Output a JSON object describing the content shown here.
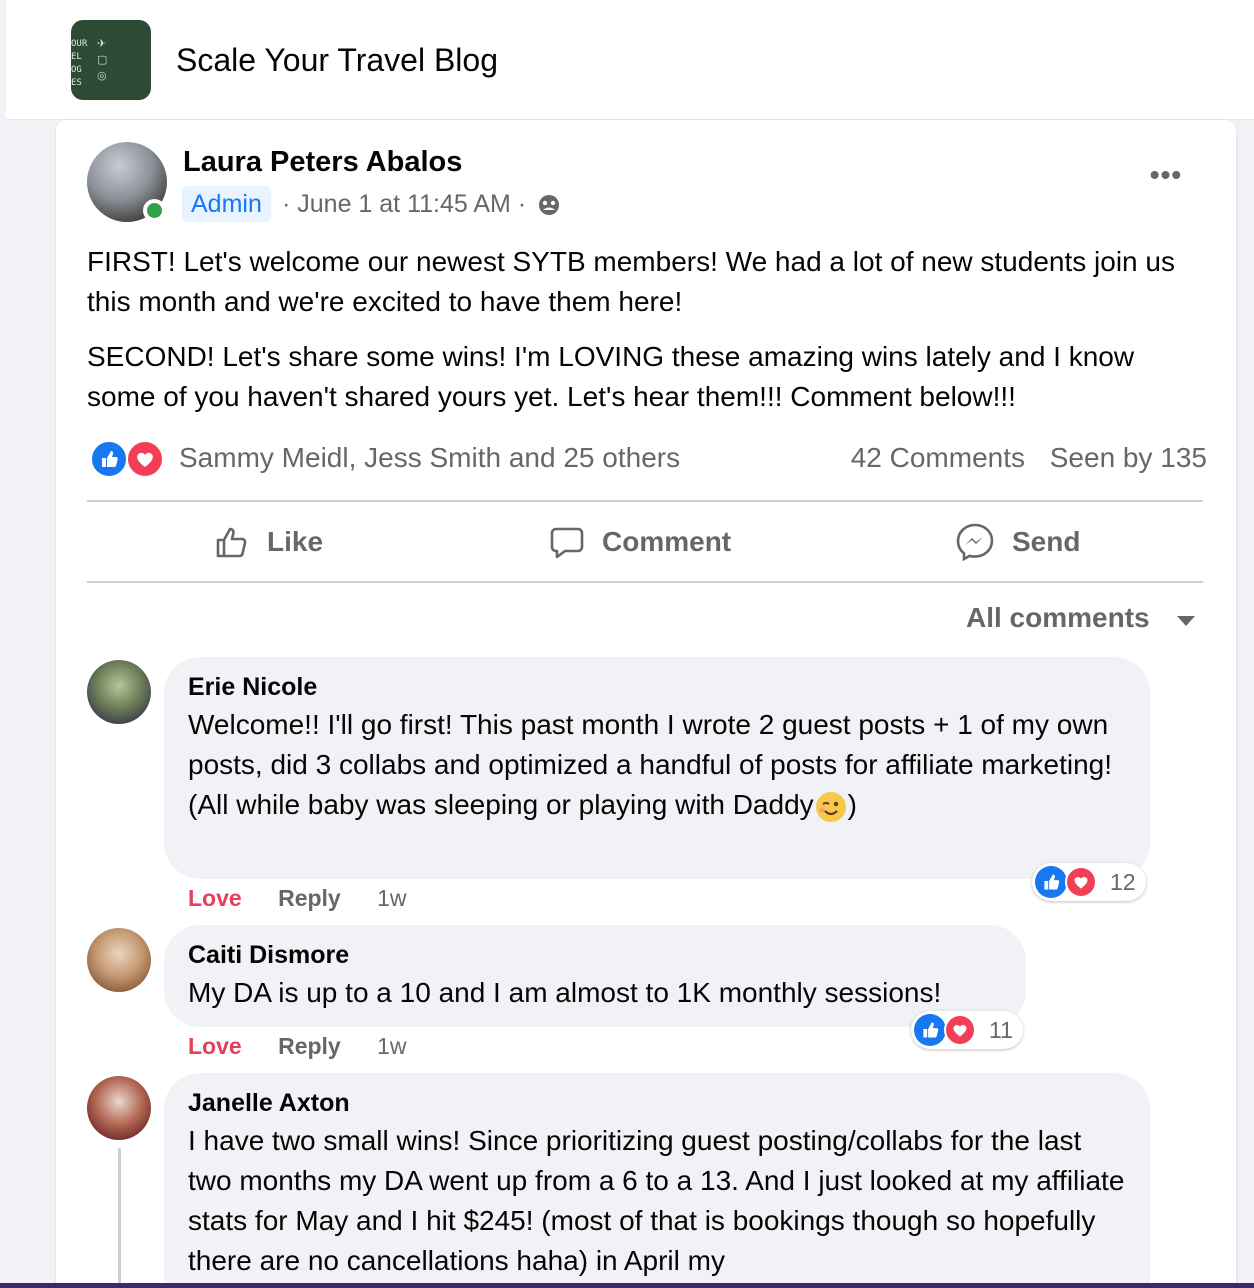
{
  "group": {
    "title": "Scale Your Travel Blog",
    "logo_text": "OUR\nEL\nOG\nES"
  },
  "post": {
    "author": "Laura Peters Abalos",
    "badge": "Admin",
    "meta": "· June 1 at 11:45 AM ·",
    "paragraphs": [
      "FIRST! Let's welcome our newest SYTB members! We had a lot of new students join us this month and we're excited to have them here!",
      "SECOND! Let's share some wins! I'm LOVING these amazing wins lately and I know some of you haven't shared yours yet. Let's hear them!!! Comment below!!!"
    ],
    "reactors": "Sammy Meidl, Jess Smith and 25 others",
    "comments_count": "42 Comments",
    "seen_by": "Seen by 135"
  },
  "actions": {
    "like": "Like",
    "comment": "Comment",
    "send": "Send"
  },
  "filter": {
    "label": "All comments"
  },
  "comments": [
    {
      "name": "Erie Nicole",
      "text": "Welcome!! I'll go first! This past month I wrote 2 guest posts + 1 of my own posts, did 3 collabs and optimized a handful of posts for affiliate marketing! (All while baby was sleeping or playing with Daddy",
      "text_end": ")",
      "love": "Love",
      "reply": "Reply",
      "time": "1w",
      "reaction_count": "12"
    },
    {
      "name": "Caiti Dismore",
      "text": "My DA is up to a 10 and I am almost to 1K monthly sessions!",
      "love": "Love",
      "reply": "Reply",
      "time": "1w",
      "reaction_count": "11"
    },
    {
      "name": "Janelle Axton",
      "text": "I have two small wins! Since prioritizing guest posting/collabs for the last two months my DA went up from a 6 to a 13. And I just looked at my affiliate stats for May and I hit $245! (most of that is bookings though so hopefully there are no cancellations haha) in April my"
    }
  ],
  "colors": {
    "accent": "#1877f2",
    "love": "#f33e58",
    "online": "#31a24c",
    "logo_bg": "#2d4a35"
  }
}
